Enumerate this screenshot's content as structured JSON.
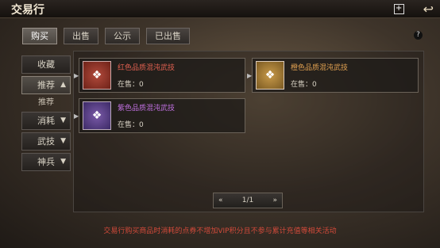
{
  "window": {
    "title": "交易行"
  },
  "tabs": [
    "购买",
    "出售",
    "公示",
    "已出售"
  ],
  "sidebar": {
    "favorites": "收藏",
    "recommend": "推荐",
    "recommend_sub": "推荐",
    "consumables": "消耗",
    "martial": "武技",
    "weapons": "神兵"
  },
  "items": [
    {
      "name": "红色品质混沌武技",
      "stock": "在售：0",
      "color": "#e06050"
    },
    {
      "name": "橙色品质混沌武技",
      "stock": "在售：0",
      "color": "#e0a050"
    },
    {
      "name": "紫色品质混沌武技",
      "stock": "在售：0",
      "color": "#c070e0"
    }
  ],
  "pager": {
    "prev": "«",
    "page": "1/1",
    "next": "»"
  },
  "notice": "交易行购买商品时消耗的点券不增加VIP积分且不参与累计充值等相关活动",
  "icons": {
    "help": "?",
    "plus": "+",
    "back": "↩"
  }
}
